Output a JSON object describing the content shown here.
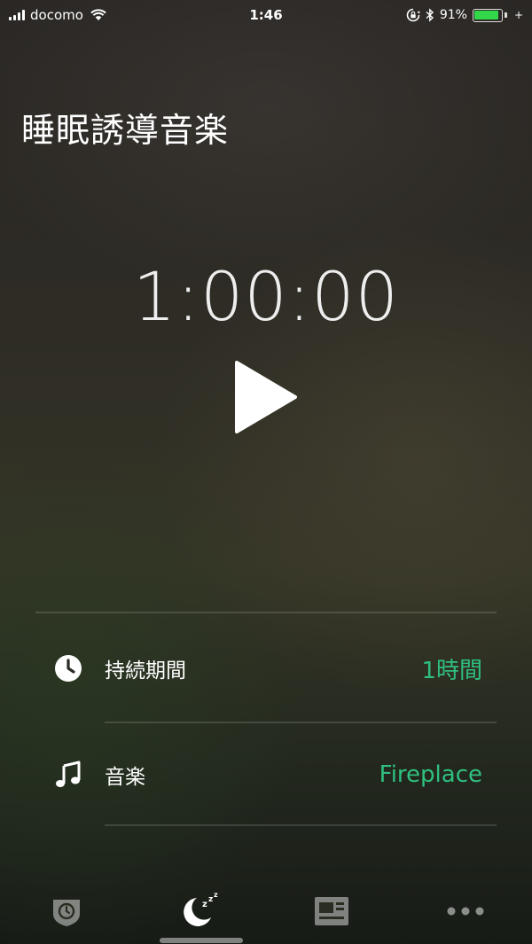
{
  "status_bar": {
    "carrier": "docomo",
    "time": "1:46",
    "battery_percent": "91%",
    "battery_level": 0.91,
    "icons": [
      "signal-icon",
      "wifi-icon",
      "rotation-lock-icon",
      "bluetooth-icon",
      "battery-icon",
      "charging-icon"
    ]
  },
  "header": {
    "title": "睡眠誘導音楽"
  },
  "timer": {
    "display": "1:00:00",
    "play_icon": "play-icon"
  },
  "settings": [
    {
      "icon": "clock-icon",
      "label": "持続期間",
      "value": "1時間"
    },
    {
      "icon": "music-note-icon",
      "label": "音楽",
      "value": "Fireplace"
    }
  ],
  "tab_bar": {
    "tabs": [
      {
        "icon": "timer-shield-icon",
        "selected": false
      },
      {
        "icon": "sleep-moon-icon",
        "selected": true
      },
      {
        "icon": "photo-frame-icon",
        "selected": false
      },
      {
        "icon": "more-dots-icon",
        "selected": false
      }
    ]
  },
  "colors": {
    "accent": "#2fbf7f",
    "battery": "#33d74a",
    "text": "#ffffff"
  }
}
